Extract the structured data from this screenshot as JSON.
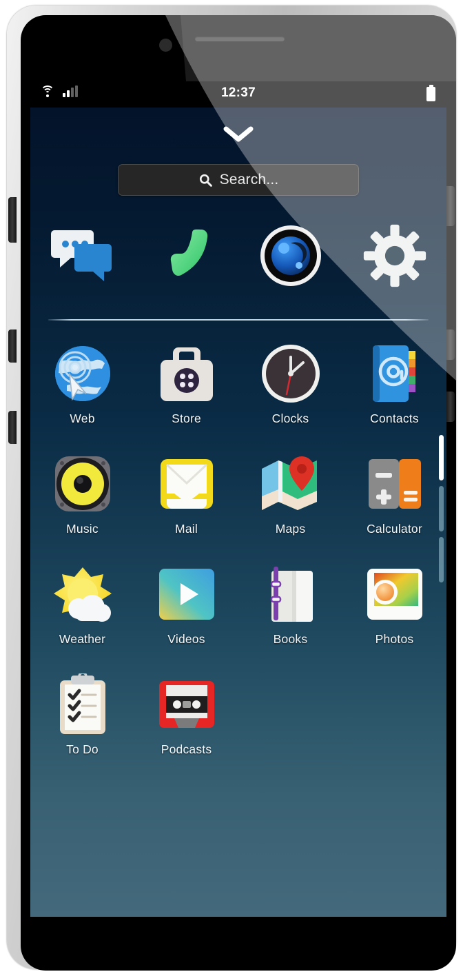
{
  "device": {
    "name": "phone-mockup"
  },
  "status_bar": {
    "wifi_icon": "wifi-icon",
    "signal_icon": "cellular-signal-icon",
    "signal_bars_total": 4,
    "signal_bars_filled": 2,
    "time": "12:37",
    "battery_icon": "battery-icon"
  },
  "shell": {
    "chevron_icon": "chevron-down-icon",
    "search": {
      "icon": "search-icon",
      "placeholder": "Search...",
      "value": ""
    },
    "page_indicator": {
      "pages": 3,
      "current": 1
    }
  },
  "favorites": [
    {
      "label": "Messages",
      "icon": "messages-icon"
    },
    {
      "label": "Phone",
      "icon": "phone-icon"
    },
    {
      "label": "Camera",
      "icon": "camera-icon"
    },
    {
      "label": "Settings",
      "icon": "settings-gear-icon"
    }
  ],
  "apps": [
    {
      "label": "Web",
      "icon": "web-globe-icon"
    },
    {
      "label": "Store",
      "icon": "store-bag-icon"
    },
    {
      "label": "Clocks",
      "icon": "clocks-icon"
    },
    {
      "label": "Contacts",
      "icon": "contacts-book-icon"
    },
    {
      "label": "Music",
      "icon": "music-speaker-icon"
    },
    {
      "label": "Mail",
      "icon": "mail-envelope-icon"
    },
    {
      "label": "Maps",
      "icon": "maps-pin-icon"
    },
    {
      "label": "Calculator",
      "icon": "calculator-icon"
    },
    {
      "label": "Weather",
      "icon": "weather-sun-cloud-icon"
    },
    {
      "label": "Videos",
      "icon": "videos-play-icon"
    },
    {
      "label": "Books",
      "icon": "books-icon"
    },
    {
      "label": "Photos",
      "icon": "photos-icon"
    },
    {
      "label": "To Do",
      "icon": "todo-clipboard-icon"
    },
    {
      "label": "Podcasts",
      "icon": "podcasts-cassette-icon"
    }
  ],
  "colors": {
    "bg_top": "#03132a",
    "bg_bottom": "#44697c",
    "search_bg": "#262626",
    "label_text": "#f2f6f8",
    "accent_phone_green": "#5fd98a",
    "accent_camera_blue": "#1f72d6",
    "accent_podcast_red": "#e02626",
    "accent_maps_red": "#dd3125",
    "accent_calc_orange": "#ef7d1a",
    "accent_music_yellow": "#f4e93c",
    "accent_mail_yellow": "#f3d91e"
  }
}
